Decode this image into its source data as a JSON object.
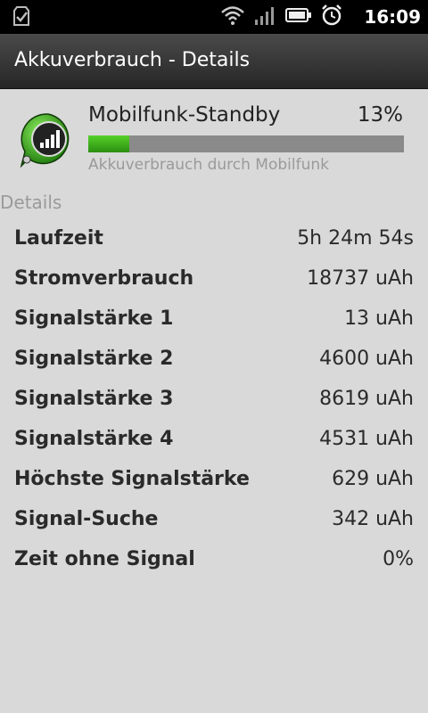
{
  "status_bar": {
    "time": "16:09",
    "icons": [
      "checkmark-notification-icon",
      "wifi-icon",
      "signal-icon",
      "battery-icon",
      "alarm-clock-icon"
    ]
  },
  "title_bar": {
    "title": "Akkuverbrauch - Details"
  },
  "header": {
    "name": "Mobilfunk-Standby",
    "percent_label": "13%",
    "usage_fraction": 0.13,
    "caption": "Akkuverbrauch durch Mobilfunk",
    "bar_color": "#3fb81d",
    "icon": "cell-signal-app-icon"
  },
  "details": {
    "section_title": "Details",
    "rows": [
      {
        "label": "Laufzeit",
        "value": "5h 24m 54s"
      },
      {
        "label": "Stromverbrauch",
        "value": "18737 uAh"
      },
      {
        "label": "Signalstärke 1",
        "value": "13 uAh"
      },
      {
        "label": "Signalstärke 2",
        "value": "4600 uAh"
      },
      {
        "label": "Signalstärke 3",
        "value": "8619 uAh"
      },
      {
        "label": "Signalstärke 4",
        "value": "4531 uAh"
      },
      {
        "label": "Höchste Signalstärke",
        "value": "629 uAh"
      },
      {
        "label": "Signal-Suche",
        "value": "342 uAh"
      },
      {
        "label": "Zeit ohne Signal",
        "value": "0%"
      }
    ]
  }
}
